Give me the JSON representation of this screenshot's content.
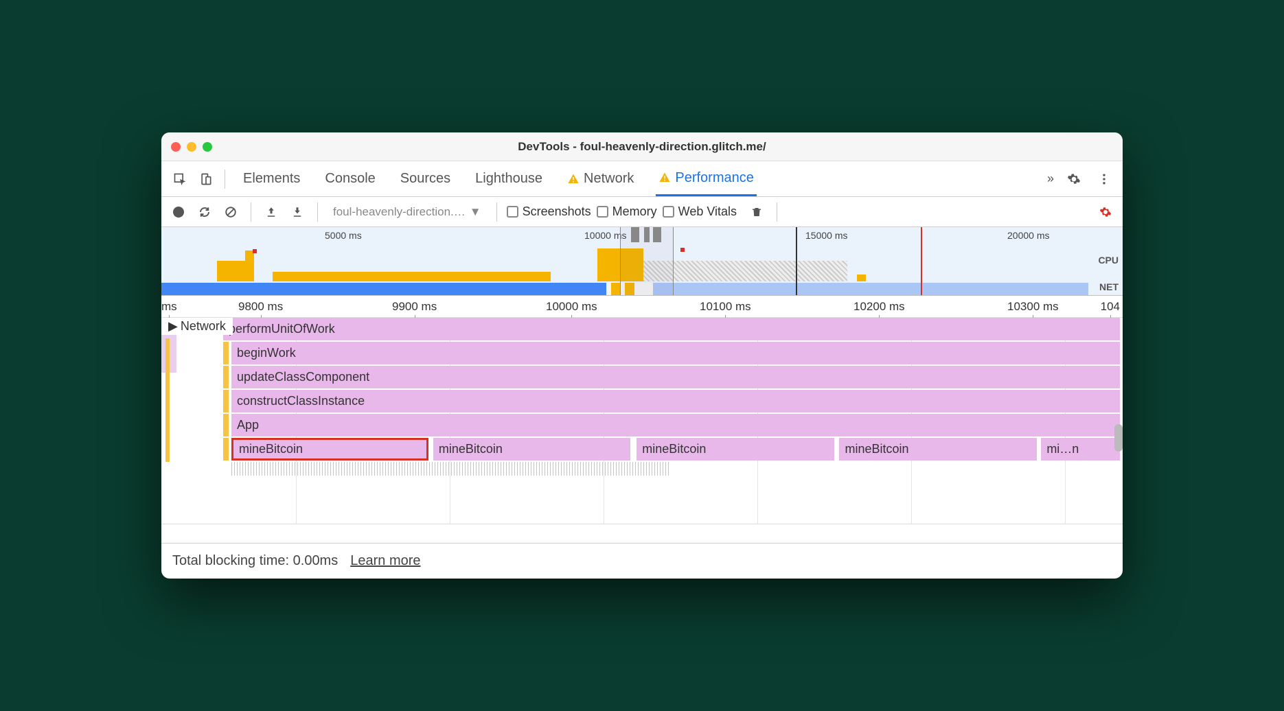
{
  "window": {
    "title": "DevTools - foul-heavenly-direction.glitch.me/"
  },
  "tabs": {
    "elements": "Elements",
    "console": "Console",
    "sources": "Sources",
    "lighthouse": "Lighthouse",
    "network": "Network",
    "performance": "Performance"
  },
  "toolbar": {
    "profile_dropdown": "foul-heavenly-direction.…",
    "screenshots": "Screenshots",
    "memory": "Memory",
    "web_vitals": "Web Vitals"
  },
  "overview": {
    "ticks": [
      "5000 ms",
      "10000 ms",
      "15000 ms",
      "20000 ms"
    ],
    "cpu_label": "CPU",
    "net_label": "NET"
  },
  "timeline": {
    "left_edge": "ms",
    "ticks": [
      "9800 ms",
      "9900 ms",
      "10000 ms",
      "10100 ms",
      "10200 ms",
      "10300 ms"
    ],
    "right_edge": "104"
  },
  "network_section": "Network",
  "flame": {
    "rows": [
      {
        "label": "performUnitOfWork"
      },
      {
        "label": "beginWork"
      },
      {
        "label": "updateClassComponent"
      },
      {
        "label": "constructClassInstance"
      },
      {
        "label": "App"
      }
    ],
    "mine": [
      "mineBitcoin",
      "mineBitcoin",
      "mineBitcoin",
      "mineBitcoin",
      "mi…n"
    ]
  },
  "footer": {
    "blocking": "Total blocking time: 0.00ms",
    "learn_more": "Learn more"
  }
}
